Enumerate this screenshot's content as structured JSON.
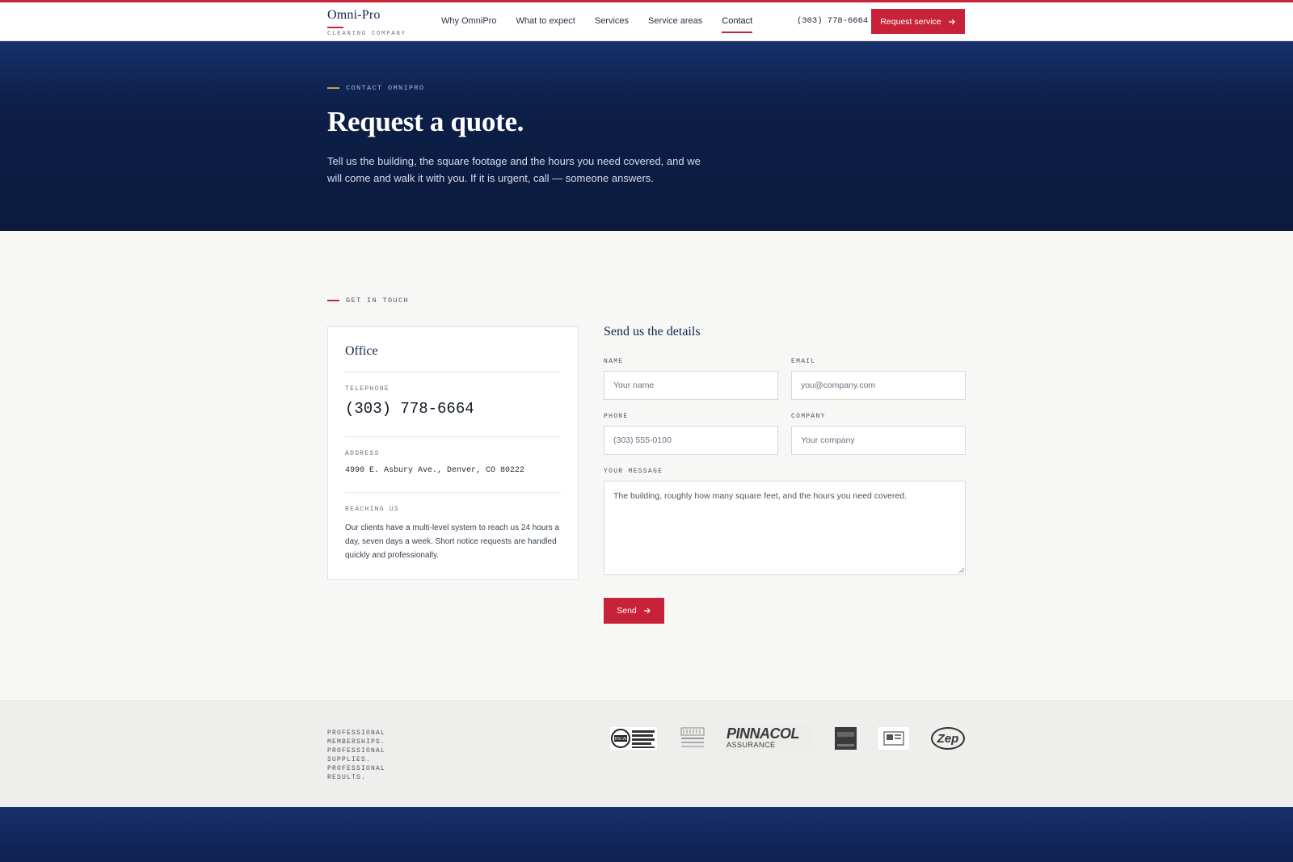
{
  "brand": {
    "name": "Omni-Pro",
    "tagline": "CLEANING COMPANY"
  },
  "nav": {
    "items": [
      {
        "label": "Why OmniPro",
        "active": false
      },
      {
        "label": "What to expect",
        "active": false
      },
      {
        "label": "Services",
        "active": false
      },
      {
        "label": "Service areas",
        "active": false
      },
      {
        "label": "Contact",
        "active": true
      }
    ],
    "phone": "(303) 778-6664",
    "cta_label": "Request service"
  },
  "hero": {
    "eyebrow": "CONTACT OMNIPRO",
    "title": "Request a quote.",
    "description": "Tell us the building, the square footage and the hours you need covered, and we will come and walk it with you. If it is urgent, call — someone answers."
  },
  "section": {
    "eyebrow": "GET IN TOUCH"
  },
  "office": {
    "title": "Office",
    "telephone_label": "TELEPHONE",
    "telephone": "(303) 778-6664",
    "address_label": "ADDRESS",
    "address": "4990 E. Asbury Ave., Denver, CO 80222",
    "reaching_label": "REACHING US",
    "reaching_text": "Our clients have a multi-level system to reach us 24 hours a day, seven days a week. Short notice requests are handled quickly and professionally."
  },
  "form": {
    "title": "Send us the details",
    "name_label": "NAME",
    "name_placeholder": "Your name",
    "email_label": "EMAIL",
    "email_placeholder": "you@company.com",
    "phone_label": "PHONE",
    "phone_placeholder": "(303) 555-0100",
    "company_label": "COMPANY",
    "company_placeholder": "Your company",
    "message_label": "YOUR MESSAGE",
    "message_placeholder": "The building, roughly how many square feet, and the hours you need covered.",
    "send_label": "Send"
  },
  "memberships": {
    "text": "PROFESSIONAL MEMBERSHIPS. PROFESSIONAL SUPPLIES. PROFESSIONAL RESULTS.",
    "logos": [
      {
        "name": "bsci-logo",
        "text": "Building Service Contractors Association International"
      },
      {
        "name": "colorado-restaurant-association-logo",
        "text": "COLORADO RESTAURANT ASSOCIATION"
      },
      {
        "name": "pinnacol-assurance-logo",
        "text": "PINNACOL",
        "subtext": "ASSURANCE"
      },
      {
        "name": "hillyard-logo",
        "text": "HILLYARD"
      },
      {
        "name": "badge-logo",
        "text": ""
      },
      {
        "name": "zep-logo",
        "text": "Zep"
      }
    ]
  },
  "colors": {
    "accent": "#c8223a",
    "navy": "#14244d",
    "hero_bg": "#0d1f48",
    "gold": "#c8a24a"
  },
  "icons": {
    "arrow": "arrow-right-icon"
  }
}
